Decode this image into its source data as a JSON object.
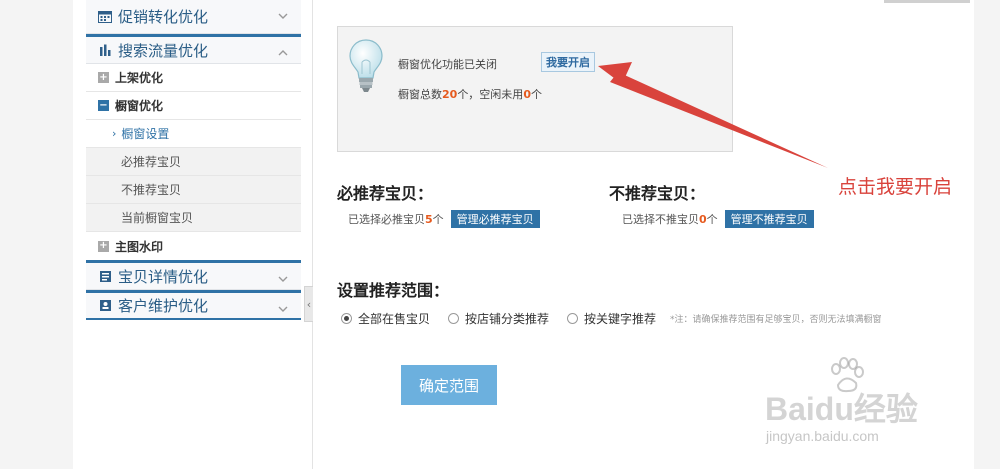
{
  "sidebar": {
    "groups": [
      {
        "label": "促销转化优化",
        "icon": "calendar-icon"
      },
      {
        "label": "搜索流量优化",
        "icon": "bar-chart-icon"
      },
      {
        "label": "宝贝详情优化",
        "icon": "page-icon"
      },
      {
        "label": "客户维护优化",
        "icon": "contact-card-icon"
      }
    ],
    "search_items": {
      "listing": "上架优化",
      "window": "橱窗优化",
      "window_settings": "橱窗设置",
      "must_recommend": "必推荐宝贝",
      "not_recommend": "不推荐宝贝",
      "current_window": "当前橱窗宝贝",
      "watermark": "主图水印"
    }
  },
  "info": {
    "status": "橱窗优化功能已关闭",
    "enable_button": "我要开启",
    "total_prefix": "橱窗总数",
    "total_count": "20",
    "total_mid": "个，空闲未用",
    "idle_count": "0",
    "total_suffix": "个"
  },
  "must": {
    "title": "必推荐宝贝：",
    "selected_prefix": "已选择必推宝贝",
    "count": "5",
    "suffix": "个",
    "button": "管理必推荐宝贝"
  },
  "not": {
    "title": "不推荐宝贝：",
    "selected_prefix": "已选择不推宝贝",
    "count": "0",
    "suffix": "个",
    "button": "管理不推荐宝贝"
  },
  "scope": {
    "title": "设置推荐范围：",
    "options": [
      "全部在售宝贝",
      "按店铺分类推荐",
      "按关键字推荐"
    ],
    "selected": "全部在售宝贝",
    "note": "*注：请确保推荐范围有足够宝贝，否则无法填满橱窗",
    "confirm": "确定范围"
  },
  "annotation": {
    "label": "点击我要开启",
    "color": "#d9433c"
  },
  "watermark": {
    "main": "Baidu经验",
    "sub": "jingyan.baidu.com"
  },
  "colors": {
    "accent": "#2f72a6",
    "highlight": "#e65a1e",
    "confirm_button": "#6cb0de"
  }
}
